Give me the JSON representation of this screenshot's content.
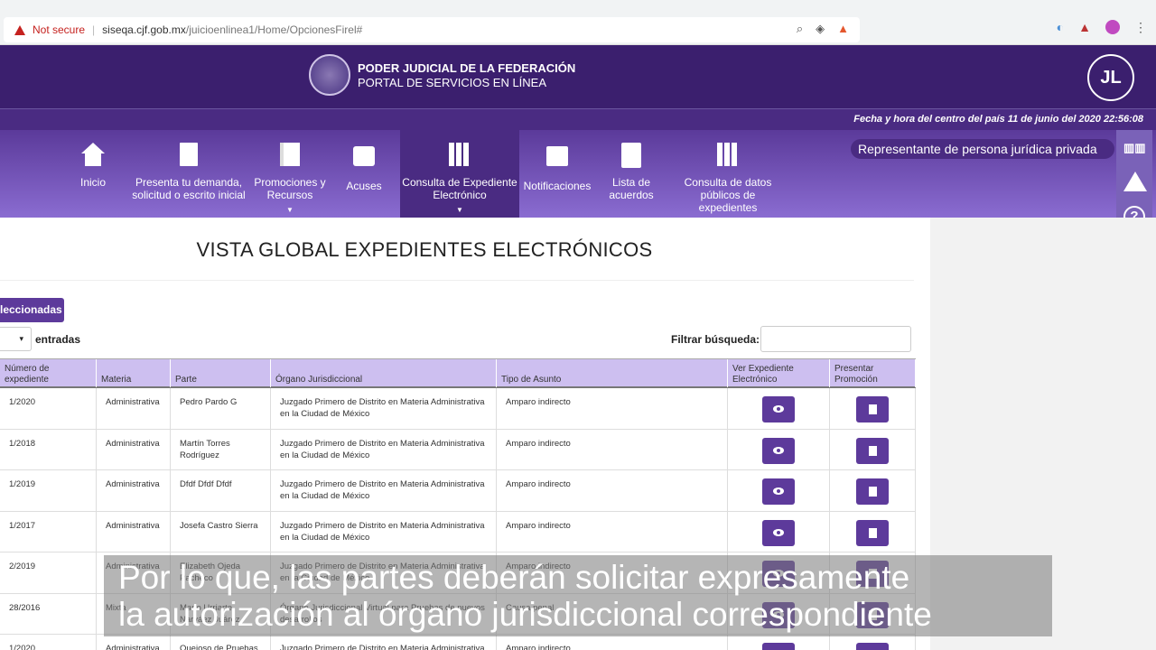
{
  "browser": {
    "not_secure": "Not secure",
    "url_host": "siseqa.cjf.gob.mx",
    "url_path": "/juicioenlinea1/Home/OpcionesFirel#"
  },
  "header": {
    "title_line1": "PODER JUDICIAL DE LA FEDERACIÓN",
    "title_line2": "PORTAL DE SERVICIOS EN LÍNEA",
    "avatar_initials": "JL",
    "datetime": "Fecha y hora del centro del país 11 de junio del 2020 22:56:08"
  },
  "nav": {
    "items": [
      {
        "label": "Inicio",
        "icon": "home-icon"
      },
      {
        "label": "Presenta tu demanda, solicitud o escrito inicial",
        "icon": "document-icon"
      },
      {
        "label": "Promociones y Recursos",
        "icon": "book-icon"
      },
      {
        "label": "Acuses",
        "icon": "printer-icon"
      },
      {
        "label": "Consulta de Expediente Electrónico",
        "icon": "binders-icon"
      },
      {
        "label": "Notificaciones",
        "icon": "mail-icon"
      },
      {
        "label": "Lista de acuerdos",
        "icon": "list-icon"
      },
      {
        "label": "Consulta de datos públicos de expedientes",
        "icon": "binders-icon"
      }
    ],
    "role": "Representante de persona jurídica privada"
  },
  "main": {
    "title": "VISTA GLOBAL EXPEDIENTES ELECTRÓNICOS",
    "selected_button": "leccionadas",
    "entries_label": "entradas",
    "filter_label": "Filtrar búsqueda:",
    "filter_value": ""
  },
  "table": {
    "headers": [
      "Número de expediente",
      "Materia",
      "Parte",
      "Órgano Jurisdiccional",
      "Tipo de Asunto",
      "Ver Expediente Electrónico",
      "Presentar Promoción"
    ],
    "rows": [
      {
        "numero": "1/2020",
        "materia": "Administrativa",
        "parte": "Pedro Pardo G",
        "organo": "Juzgado Primero de Distrito en Materia Administrativa en la Ciudad de México",
        "tipo": "Amparo indirecto"
      },
      {
        "numero": "1/2018",
        "materia": "Administrativa",
        "parte": "Martín Torres Rodríguez",
        "organo": "Juzgado Primero de Distrito en Materia Administrativa en la Ciudad de México",
        "tipo": "Amparo indirecto"
      },
      {
        "numero": "1/2019",
        "materia": "Administrativa",
        "parte": "Dfdf Dfdf Dfdf",
        "organo": "Juzgado Primero de Distrito en Materia Administrativa en la Ciudad de México",
        "tipo": "Amparo indirecto"
      },
      {
        "numero": "1/2017",
        "materia": "Administrativa",
        "parte": "Josefa Castro Sierra",
        "organo": "Juzgado Primero de Distrito en Materia Administrativa en la Ciudad de México",
        "tipo": "Amparo indirecto"
      },
      {
        "numero": "2/2019",
        "materia": "Administrativa",
        "parte": "Elizabeth Ojeda Pacheco",
        "organo": "Juzgado Primero de Distrito en Materia Administrativa en la Ciudad de México",
        "tipo": "Amparo indirecto"
      },
      {
        "numero": "28/2016",
        "materia": "Mixta",
        "parte": "Mario Urriarte Narváez Juárez",
        "organo": "Órgano Jurisdiccional Virtual para Pruebas de nuevos desarrollos",
        "tipo": "Causa penal"
      },
      {
        "numero": "1/2020",
        "materia": "Administrativa",
        "parte": "Quejoso de Pruebas",
        "organo": "Juzgado Primero de Distrito en Materia Administrativa",
        "tipo": "Amparo indirecto"
      }
    ]
  },
  "subtitle": {
    "line1": "Por lo que, las partes deberán solicitar expresamente",
    "line2": "la autorización al órgano jurisdiccional correspondiente"
  }
}
